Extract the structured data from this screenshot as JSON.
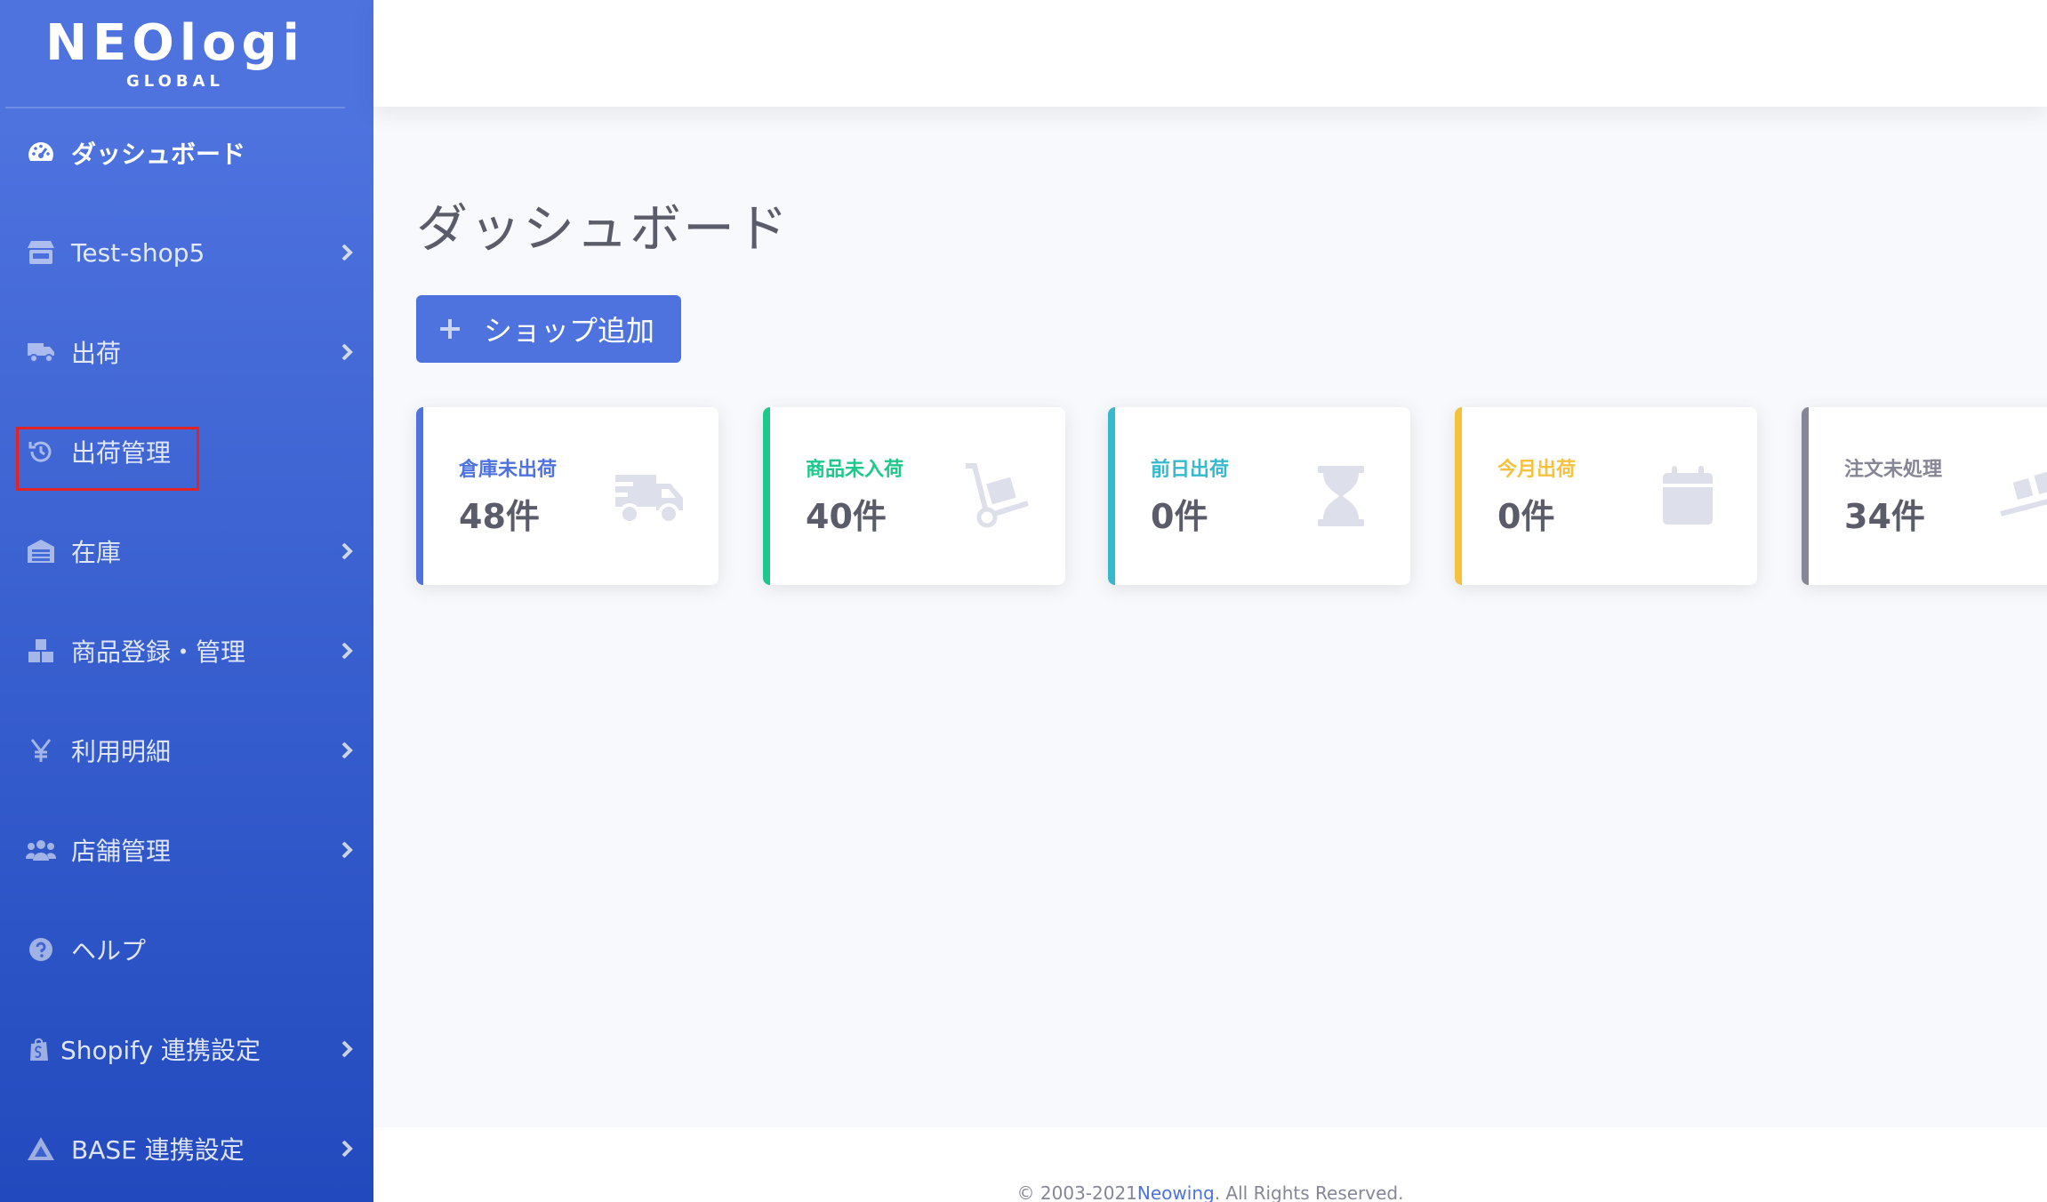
{
  "sidebar": {
    "brand": {
      "name": "NEOlogi",
      "tagline": "GLOBAL"
    },
    "items": [
      {
        "label": "ダッシュボード",
        "icon": "dashboard-icon",
        "active": true,
        "has_chevron": false
      },
      {
        "label": "Test-shop5",
        "icon": "store-icon",
        "active": false,
        "has_chevron": true
      },
      {
        "label": "出荷",
        "icon": "truck-icon",
        "active": false,
        "has_chevron": true
      },
      {
        "label": "出荷管理",
        "icon": "history-icon",
        "active": false,
        "has_chevron": false
      },
      {
        "label": "在庫",
        "icon": "warehouse-icon",
        "active": false,
        "has_chevron": true
      },
      {
        "label": "商品登録・管理",
        "icon": "boxes-icon",
        "active": false,
        "has_chevron": true
      },
      {
        "label": "利用明細",
        "icon": "yen-icon",
        "active": false,
        "has_chevron": true
      },
      {
        "label": "店舗管理",
        "icon": "users-icon",
        "active": false,
        "has_chevron": true
      },
      {
        "label": "ヘルプ",
        "icon": "question-icon",
        "active": false,
        "has_chevron": false
      },
      {
        "label": "Shopify 連携設定",
        "icon": "shopify-icon",
        "active": false,
        "has_chevron": true
      },
      {
        "label": "BASE 連携設定",
        "icon": "base-icon",
        "active": false,
        "has_chevron": true
      }
    ]
  },
  "main": {
    "title": "ダッシュボード",
    "add_shop_label": "ショップ追加",
    "cards": [
      {
        "label": "倉庫未出荷",
        "value": "48件",
        "color": "#4e73df",
        "icon": "truck-icon"
      },
      {
        "label": "商品未入荷",
        "value": "40件",
        "color": "#1cc88a",
        "icon": "dolly-icon"
      },
      {
        "label": "前日出荷",
        "value": "0件",
        "color": "#36b9cc",
        "icon": "hourglass-icon"
      },
      {
        "label": "今月出荷",
        "value": "0件",
        "color": "#f6c23e",
        "icon": "calendar-icon"
      },
      {
        "label": "注文未処理",
        "value": "34件",
        "color": "#858796",
        "icon": "dolly-flatbed-icon"
      }
    ]
  },
  "footer": {
    "prefix": "© 2003-2021",
    "link": "Neowing",
    "suffix": ". All Rights Reserved."
  }
}
